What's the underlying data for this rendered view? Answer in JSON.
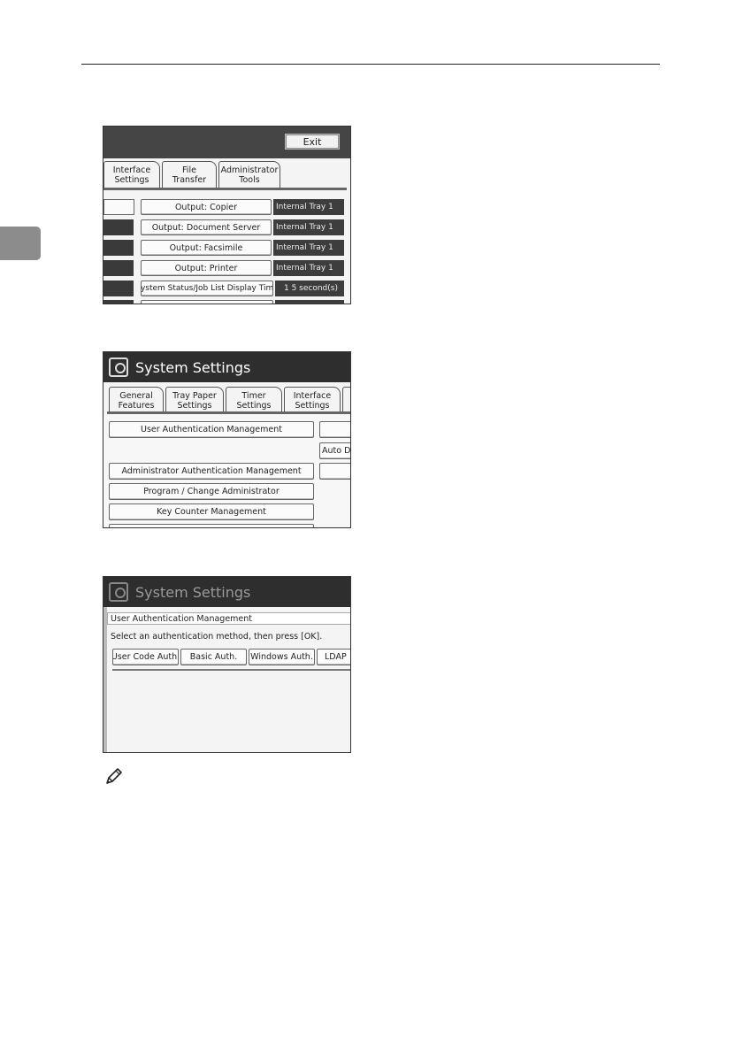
{
  "shot1": {
    "exit_label": "Exit",
    "tabs": [
      {
        "label": "Interface\nSettings"
      },
      {
        "label": "File\nTransfer"
      },
      {
        "label": "Administrator\nTools"
      }
    ],
    "rows": [
      {
        "label": "Output: Copier",
        "value": "Internal Tray 1"
      },
      {
        "label": "Output: Document Server",
        "value": "Internal Tray 1"
      },
      {
        "label": "Output: Facsimile",
        "value": "Internal Tray 1"
      },
      {
        "label": "Output: Printer",
        "value": "Internal Tray 1"
      },
      {
        "label": "System Status/Job List Display Time",
        "value": "1 5 second(s)"
      }
    ]
  },
  "shot2": {
    "title": "System Settings",
    "tabs": [
      {
        "label": "General\nFeatures"
      },
      {
        "label": "Tray Paper\nSettings"
      },
      {
        "label": "Timer\nSettings"
      },
      {
        "label": "Interface\nSettings"
      }
    ],
    "buttons": {
      "user_auth": "User Authentication Management",
      "admin_auth": "Administrator Authentication Management",
      "program_admin": "Program / Change Administrator",
      "key_counter": "Key Counter Management",
      "auto_de": "Auto De"
    }
  },
  "shot3": {
    "title": "System Settings",
    "header": "User Authentication Management",
    "instruction": "Select an authentication method, then press [OK].",
    "options": [
      "User Code Auth.",
      "Basic Auth.",
      "Windows Auth.",
      "LDAP"
    ]
  },
  "icons": {
    "note": "pencil-note-icon",
    "system_settings": "system-settings-icon"
  }
}
